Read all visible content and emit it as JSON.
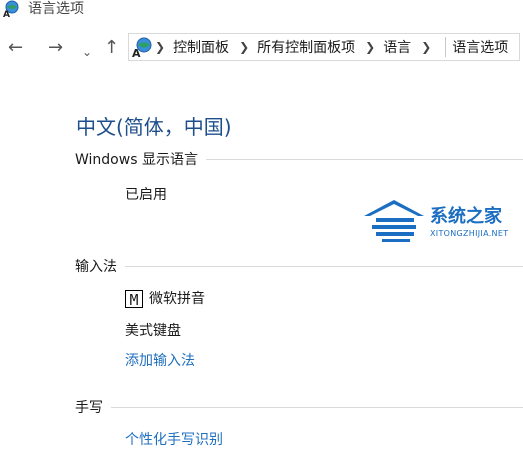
{
  "window": {
    "title": "语言选项"
  },
  "nav": {
    "back": "←",
    "forward": "→",
    "recent": "⌄",
    "up": "↑"
  },
  "breadcrumb": {
    "items": [
      "控制面板",
      "所有控制面板项",
      "语言",
      "语言选项"
    ]
  },
  "main": {
    "title": "中文(简体，中国)",
    "display_section": {
      "label": "Windows 显示语言",
      "status": "已启用"
    },
    "input_section": {
      "label": "输入法",
      "ime_icon_glyph": "M",
      "ime_name": "微软拼音",
      "keyboard": "美式键盘",
      "add_link": "添加输入法"
    },
    "handwriting_section": {
      "label": "手写",
      "personalize_link": "个性化手写识别"
    }
  },
  "watermark": {
    "name": "系统之家",
    "url": "XITONGZHIJIA.NET",
    "color": "#1b6ec2"
  },
  "colors": {
    "title": "#1e4e8c",
    "link": "#1f6fbf"
  }
}
